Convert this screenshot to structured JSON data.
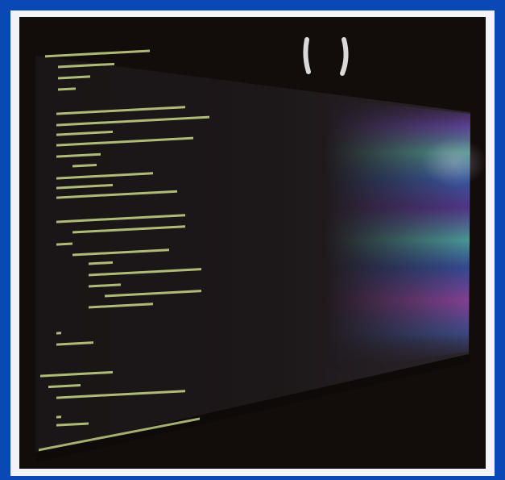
{
  "image": {
    "subject": "",
    "colors": {
      "border": "#0a48b6",
      "matte": "#f2f3f6",
      "background": "#120c0a",
      "screen": "#1b1618",
      "code_text": "#c9d98a"
    }
  }
}
